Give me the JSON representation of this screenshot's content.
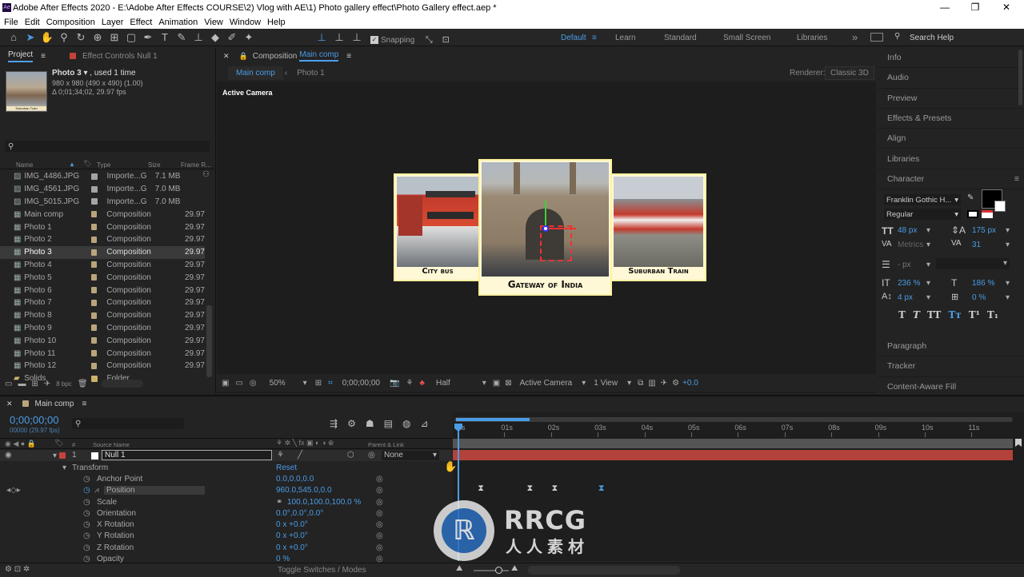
{
  "window": {
    "title": "Adobe After Effects 2020 - E:\\Adobe After Effects COURSE\\2) Vlog with AE\\1) Photo gallery effect\\Photo Gallery effect.aep *",
    "app_icon": "Ae",
    "minimize": "—",
    "maximize": "❐",
    "close": "✕"
  },
  "menu": [
    "File",
    "Edit",
    "Composition",
    "Layer",
    "Effect",
    "Animation",
    "View",
    "Window",
    "Help"
  ],
  "toolbar": {
    "snapping": "Snapping",
    "workspaces": [
      "Default",
      "Learn",
      "Standard",
      "Small Screen",
      "Libraries"
    ],
    "active_workspace": "Default",
    "more": "»",
    "search_help": "Search Help"
  },
  "project": {
    "tab_project": "Project",
    "tab_effects": "Effect Controls Null 1",
    "selected_name": "Photo 3",
    "selected_used": ", used 1 time",
    "selected_dims": "980 x 980  (490 x 490) (1.00)",
    "selected_dur": "Δ 0;01;34;02, 29.97 fps",
    "thumb_caption": "Suburban Train",
    "search_icon": "search-icon",
    "columns": {
      "name": "Name",
      "type": "Type",
      "size": "Size",
      "frame_rate": "Frame R..."
    },
    "items": [
      {
        "name": "IMG_4486.JPG",
        "type": "Importe...G",
        "size": "7.1 MB",
        "fr": "",
        "kind": "image",
        "color": "#a4a4a4"
      },
      {
        "name": "IMG_4561.JPG",
        "type": "Importe...G",
        "size": "7.0 MB",
        "fr": "",
        "kind": "image",
        "color": "#a4a4a4"
      },
      {
        "name": "IMG_5015.JPG",
        "type": "Importe...G",
        "size": "7.0 MB",
        "fr": "",
        "kind": "image",
        "color": "#a4a4a4"
      },
      {
        "name": "Main comp",
        "type": "Composition",
        "size": "",
        "fr": "29.97",
        "kind": "comp",
        "color": "#b9a57c"
      },
      {
        "name": "Photo 1",
        "type": "Composition",
        "size": "",
        "fr": "29.97",
        "kind": "comp",
        "color": "#b9a57c"
      },
      {
        "name": "Photo 2",
        "type": "Composition",
        "size": "",
        "fr": "29.97",
        "kind": "comp",
        "color": "#b9a57c"
      },
      {
        "name": "Photo 3",
        "type": "Composition",
        "size": "",
        "fr": "29.97",
        "kind": "comp",
        "color": "#b9a57c",
        "selected": true
      },
      {
        "name": "Photo 4",
        "type": "Composition",
        "size": "",
        "fr": "29.97",
        "kind": "comp",
        "color": "#b9a57c"
      },
      {
        "name": "Photo 5",
        "type": "Composition",
        "size": "",
        "fr": "29.97",
        "kind": "comp",
        "color": "#b9a57c"
      },
      {
        "name": "Photo 6",
        "type": "Composition",
        "size": "",
        "fr": "29.97",
        "kind": "comp",
        "color": "#b9a57c"
      },
      {
        "name": "Photo 7",
        "type": "Composition",
        "size": "",
        "fr": "29.97",
        "kind": "comp",
        "color": "#b9a57c"
      },
      {
        "name": "Photo 8",
        "type": "Composition",
        "size": "",
        "fr": "29.97",
        "kind": "comp",
        "color": "#b9a57c"
      },
      {
        "name": "Photo 9",
        "type": "Composition",
        "size": "",
        "fr": "29.97",
        "kind": "comp",
        "color": "#b9a57c"
      },
      {
        "name": "Photo 10",
        "type": "Composition",
        "size": "",
        "fr": "29.97",
        "kind": "comp",
        "color": "#b9a57c"
      },
      {
        "name": "Photo 11",
        "type": "Composition",
        "size": "",
        "fr": "29.97",
        "kind": "comp",
        "color": "#b9a57c"
      },
      {
        "name": "Photo 12",
        "type": "Composition",
        "size": "",
        "fr": "29.97",
        "kind": "comp",
        "color": "#b9a57c"
      },
      {
        "name": "Solids",
        "type": "Folder",
        "size": "",
        "fr": "",
        "kind": "folder",
        "color": "#c9b26a"
      }
    ],
    "bpc": "8 bpc"
  },
  "composition": {
    "panel_label": "Composition",
    "comp_name": "Main comp",
    "tabs": [
      "Main comp",
      "Photo 1"
    ],
    "renderer_label": "Renderer:",
    "renderer": "Classic 3D",
    "active_camera_label": "Active Camera",
    "bg_color": "#f2b43a",
    "photos": [
      {
        "caption": "City bus"
      },
      {
        "caption": "Gateway of India"
      },
      {
        "caption": "Suburban Train"
      }
    ],
    "footer": {
      "zoom": "50%",
      "timecode": "0;00;00;00",
      "resolution": "Half",
      "view": "Active Camera",
      "views": "1 View",
      "exposure": "+0.0"
    }
  },
  "right_panels": {
    "items_top": [
      "Info",
      "Audio",
      "Preview",
      "Effects & Presets",
      "Align",
      "Libraries"
    ],
    "character": "Character",
    "font": "Franklin Gothic H...",
    "style": "Regular",
    "size": "48 px",
    "leading": "175 px",
    "kerning": "Metrics",
    "tracking": "31",
    "stroke": "- px",
    "vscale": "236 %",
    "hscale": "186 %",
    "baseline": "4 px",
    "tsume": "0 %",
    "styles": [
      "T",
      "T",
      "TT",
      "Tт",
      "T¹",
      "T₁"
    ],
    "items_bottom": [
      "Paragraph",
      "Tracker",
      "Content-Aware Fill"
    ]
  },
  "timeline": {
    "comp_tab": "Main comp",
    "timecode": "0;00;00;00",
    "timecode_sub": "00000 (29.97 fps)",
    "col_source": "Source Name",
    "col_parent": "Parent & Link",
    "layer": {
      "num": "1",
      "name": "Null 1",
      "parent": "None",
      "color": "#c5423b"
    },
    "transform": "Transform",
    "reset": "Reset",
    "props": [
      {
        "name": "Anchor Point",
        "value": "0.0,0.0,0.0"
      },
      {
        "name": "Position",
        "value": "960.0,545.0,0.0",
        "keyed": true,
        "selected": true
      },
      {
        "name": "Scale",
        "value": "100.0,100.0,100.0 %",
        "link": true
      },
      {
        "name": "Orientation",
        "value": "0.0°,0.0°,0.0°"
      },
      {
        "name": "X Rotation",
        "value": "0 x +0.0°"
      },
      {
        "name": "Y Rotation",
        "value": "0 x +0.0°"
      },
      {
        "name": "Z Rotation",
        "value": "0 x +0.0°"
      },
      {
        "name": "Opacity",
        "value": "0 %"
      }
    ],
    "ruler": [
      "0s",
      "01s",
      "02s",
      "03s",
      "04s",
      "05s",
      "06s",
      "07s",
      "08s",
      "09s",
      "10s",
      "11s"
    ],
    "keyframes": [
      0.5,
      1.55,
      2.08,
      3.08
    ],
    "bottom": "Toggle Switches / Modes"
  },
  "watermark": {
    "line1": "RRCG",
    "line2": "人人素材"
  }
}
